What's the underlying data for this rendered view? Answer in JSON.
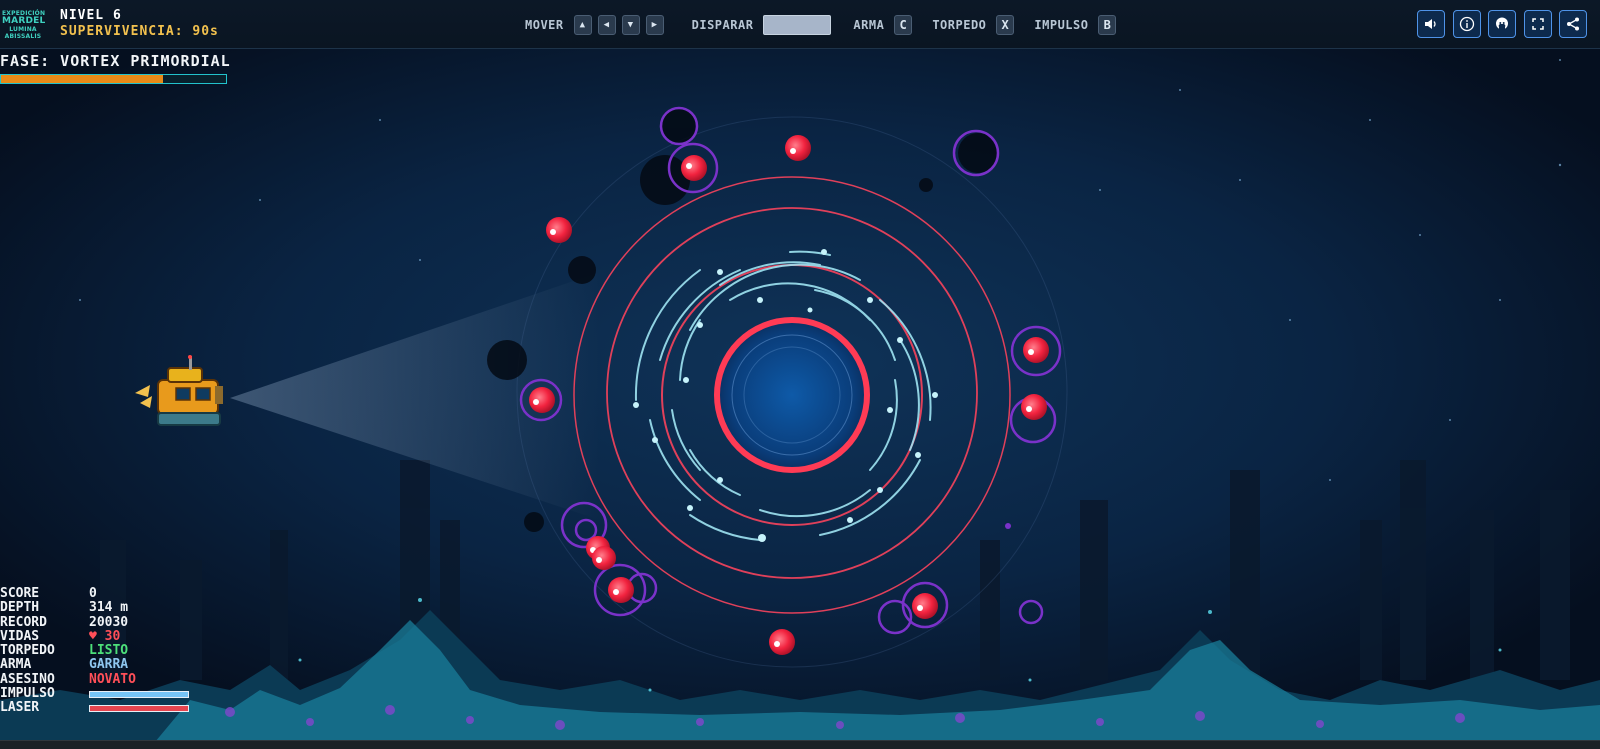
{
  "logo": {
    "lines": [
      "EXPEDICIÓN",
      "MARDEL",
      "LUMINA",
      "ABISSALIS"
    ]
  },
  "hud": {
    "level": "NIVEL 6",
    "survival": "SUPERVIVENCIA: 90s"
  },
  "controls": {
    "move_label": "MOVER",
    "move_keys": [
      "▲",
      "◀",
      "▼",
      "▶"
    ],
    "fire_label": "DISPARAR",
    "weapon_label": "ARMA",
    "weapon_key": "C",
    "torpedo_label": "TORPEDO",
    "torpedo_key": "X",
    "impulse_label": "IMPULSO",
    "impulse_key": "B"
  },
  "toolbar_icons": [
    "sound-icon",
    "info-icon",
    "github-icon",
    "fullscreen-icon",
    "share-icon"
  ],
  "phase": {
    "label": "FASE: VORTEX PRIMORDIAL",
    "progress": 0.72
  },
  "stats": {
    "score_label": "SCORE",
    "score": "0",
    "depth_label": "DEPTH",
    "depth": "314 m",
    "record_label": "RECORD",
    "record": "20030",
    "lives_label": "VIDAS",
    "lives": "♥ 30",
    "torpedo_label": "TORPEDO",
    "torpedo": "LISTO",
    "weapon_label": "ARMA",
    "weapon": "GARRA",
    "killer_label": "ASESINO",
    "killer": "NOVATO",
    "impulse_label": "IMPULSO",
    "impulse_level": 1.0,
    "laser_label": "LASER",
    "laser_level": 1.0
  },
  "colors": {
    "accent": "#4f93e8",
    "survival": "#f2c14e",
    "phase_fill": "#e88a17",
    "enemy": "#ff3b52",
    "vortex": "#e0405a"
  }
}
